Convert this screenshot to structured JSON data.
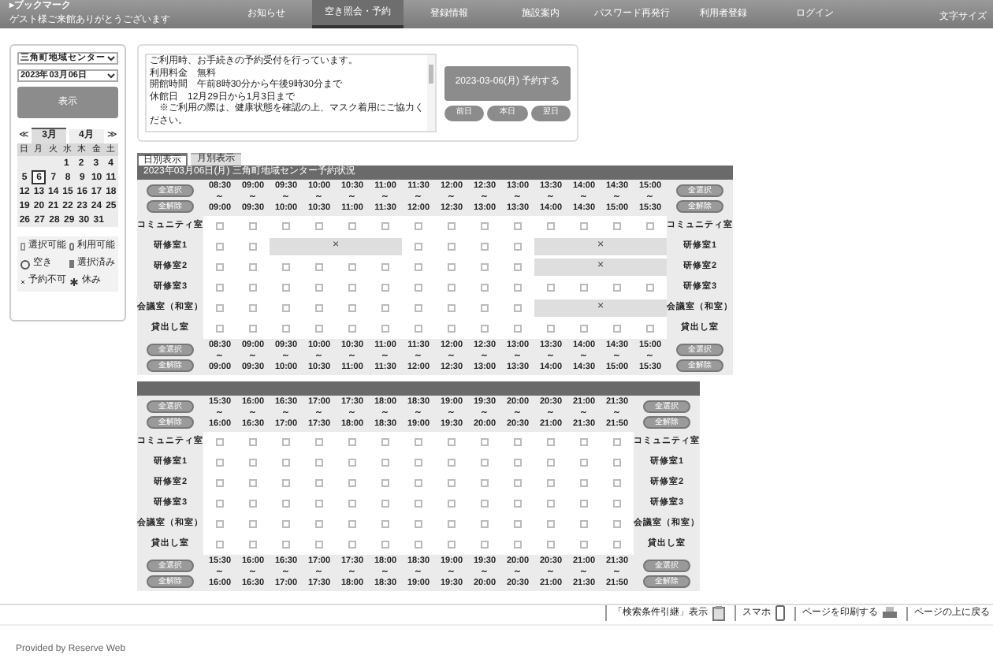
{
  "header": {
    "bookmark": "▸ブックマーク",
    "greeting": "ゲスト様ご来館ありがとうございます",
    "font_size": "文字サイズ"
  },
  "nav": [
    {
      "label": "お知らせ",
      "selected": false
    },
    {
      "label": "空き照会・予約",
      "selected": true
    },
    {
      "label": "登録情報",
      "selected": false
    },
    {
      "label": "施設案内",
      "selected": false
    },
    {
      "label": "パスワード再発行",
      "selected": false
    },
    {
      "label": "利用者登録",
      "selected": false
    },
    {
      "label": "ログイン",
      "selected": false
    }
  ],
  "sidebar": {
    "facility": "三角町地域センター",
    "date_select": "2023年03月06日",
    "show_button": "表示",
    "calendar": {
      "prev": "≪",
      "next": "≫",
      "months": [
        {
          "label": "3月",
          "selected": true
        },
        {
          "label": "4月",
          "selected": false
        }
      ],
      "weekdays": [
        "日",
        "月",
        "火",
        "水",
        "木",
        "金",
        "土"
      ],
      "weeks": [
        {
          "days": [
            {
              "day": "1",
              "selected": false
            },
            {
              "day": "2",
              "selected": false
            },
            {
              "day": "3",
              "selected": false
            },
            {
              "day": "4",
              "selected": false
            }
          ]
        },
        {
          "days": [
            {
              "day": "5",
              "selected": false
            },
            {
              "day": "6",
              "selected": true
            },
            {
              "day": "7",
              "selected": false
            },
            {
              "day": "8",
              "selected": false
            },
            {
              "day": "9",
              "selected": false
            },
            {
              "day": "10",
              "selected": false
            },
            {
              "day": "11",
              "selected": false
            }
          ]
        },
        {
          "days": [
            {
              "day": "12",
              "selected": false
            },
            {
              "day": "13",
              "selected": false
            },
            {
              "day": "14",
              "selected": false
            },
            {
              "day": "15",
              "selected": false
            },
            {
              "day": "16",
              "selected": false
            },
            {
              "day": "17",
              "selected": false
            },
            {
              "day": "18",
              "selected": false
            }
          ]
        },
        {
          "days": [
            {
              "day": "19",
              "selected": false
            },
            {
              "day": "20",
              "selected": false
            },
            {
              "day": "21",
              "selected": false
            },
            {
              "day": "22",
              "selected": false
            },
            {
              "day": "23",
              "selected": false
            },
            {
              "day": "24",
              "selected": false
            },
            {
              "day": "25",
              "selected": false
            }
          ]
        },
        {
          "days": [
            {
              "day": "26",
              "selected": false
            },
            {
              "day": "27",
              "selected": false
            },
            {
              "day": "28",
              "selected": false
            },
            {
              "day": "29",
              "selected": false
            },
            {
              "day": "30",
              "selected": false
            },
            {
              "day": "31",
              "selected": false
            }
          ]
        }
      ]
    },
    "legend": [
      {
        "kind": "checkbox",
        "label": "選択可能"
      },
      {
        "kind": "pill",
        "label": "利用可能"
      },
      {
        "kind": "circle",
        "label": "空き"
      },
      {
        "kind": "filled",
        "label": "選択済み"
      },
      {
        "kind": "cross",
        "label": "予約不可"
      },
      {
        "kind": "star",
        "label": "休み"
      }
    ]
  },
  "notice": {
    "lines": [
      "ご利用時、お手続きの予約受付を行っています。",
      "利用料金　無料",
      "開館時間　午前8時30分から午後9時30分まで",
      "休館日　12月29日から1月3日まで",
      "　※ご利用の際は、健康状態を確認の上、マスク着用にご協力ください。"
    ],
    "reserve_button": "2023-03-06(月) 予約する",
    "day_buttons": [
      "前日",
      "本日",
      "翌日"
    ]
  },
  "tabs": [
    {
      "label": "日別表示",
      "selected": true
    },
    {
      "label": "月別表示",
      "selected": false
    }
  ],
  "grids": [
    {
      "title": "2023年03月06日(月) 三角町地域センター予約状況",
      "corners": {
        "top_left": [
          "全選択",
          "全解除"
        ],
        "top_right": [
          "全選択",
          "全解除"
        ],
        "bottom_left": [
          "全選択",
          "全解除"
        ],
        "bottom_right": [
          "全選択",
          "全解除"
        ]
      },
      "times_top": [
        "08:30 ～ 09:00",
        "09:00 ～ 09:30",
        "09:30 ～ 10:00",
        "10:00 ～ 10:30",
        "10:30 ～ 11:00",
        "11:00 ～ 11:30",
        "11:30 ～ 12:00",
        "12:00 ～ 12:30",
        "12:30 ～ 13:00",
        "13:00 ～ 13:30",
        "13:30 ～ 14:00",
        "14:00 ～ 14:30",
        "14:30 ～ 15:00",
        "15:00 ～ 15:30"
      ],
      "times_bottom": [
        "08:30 ～ 09:00",
        "09:00 ～ 09:30",
        "09:30 ～ 10:00",
        "10:00 ～ 10:30",
        "10:30 ～ 11:00",
        "11:00 ～ 11:30",
        "11:30 ～ 12:00",
        "12:00 ～ 12:30",
        "12:30 ～ 13:00",
        "13:00 ～ 13:30",
        "13:30 ～ 14:00",
        "14:00 ～ 14:30",
        "14:30 ～ 15:00",
        "15:00 ～ 15:30"
      ],
      "rows": [
        {
          "label_left": "コミュニティ室",
          "label_right": "コミュニティ室",
          "booked": [
            false,
            false,
            false,
            false,
            false,
            false,
            false,
            false,
            false,
            false,
            false,
            false,
            false,
            false
          ],
          "marks": []
        },
        {
          "label_left": "研修室1",
          "label_right": "研修室1",
          "booked": [
            false,
            false,
            true,
            true,
            true,
            true,
            false,
            false,
            false,
            false,
            true,
            true,
            true,
            true
          ],
          "marks": [
            "×",
            "×"
          ]
        },
        {
          "label_left": "研修室2",
          "label_right": "研修室2",
          "booked": [
            false,
            false,
            false,
            false,
            false,
            false,
            false,
            false,
            false,
            false,
            true,
            true,
            true,
            true
          ],
          "marks": [
            "×"
          ]
        },
        {
          "label_left": "研修室3",
          "label_right": "研修室3",
          "booked": [
            false,
            false,
            false,
            false,
            false,
            false,
            false,
            false,
            false,
            false,
            false,
            false,
            false,
            false
          ],
          "marks": []
        },
        {
          "label_left": "会議室（和室）",
          "label_right": "会議室（和室）",
          "booked": [
            false,
            false,
            false,
            false,
            false,
            false,
            false,
            false,
            false,
            false,
            true,
            true,
            true,
            true
          ],
          "marks": [
            "×"
          ]
        },
        {
          "label_left": "貸出し室",
          "label_right": "貸出し室",
          "booked": [
            false,
            false,
            false,
            false,
            false,
            false,
            false,
            false,
            false,
            false,
            false,
            false,
            false,
            false
          ],
          "marks": []
        }
      ]
    },
    {
      "corners": {
        "top_left": [
          "全選択",
          "全解除"
        ],
        "top_right": [
          "全選択",
          "全解除"
        ],
        "bottom_left": [
          "全選択",
          "全解除"
        ],
        "bottom_right": [
          "全選択",
          "全解除"
        ]
      },
      "times_top": [
        "15:30 ～ 16:00",
        "16:00 ～ 16:30",
        "16:30 ～ 17:00",
        "17:00 ～ 17:30",
        "17:30 ～ 18:00",
        "18:00 ～ 18:30",
        "18:30 ～ 19:00",
        "19:00 ～ 19:30",
        "19:30 ～ 20:00",
        "20:00 ～ 20:30",
        "20:30 ～ 21:00",
        "21:00 ～ 21:30",
        "21:30 ～ 21:50"
      ],
      "times_bottom": [
        "15:30 ～ 16:00",
        "16:00 ～ 16:30",
        "16:30 ～ 17:00",
        "17:00 ～ 17:30",
        "17:30 ～ 18:00",
        "18:00 ～ 18:30",
        "18:30 ～ 19:00",
        "19:00 ～ 19:30",
        "19:30 ～ 20:00",
        "20:00 ～ 20:30",
        "20:30 ～ 21:00",
        "21:00 ～ 21:30",
        "21:30 ～ 21:50"
      ],
      "rows": [
        {
          "label_left": "コミュニティ室",
          "label_right": "コミュニティ室",
          "booked": [
            false,
            false,
            false,
            false,
            false,
            false,
            false,
            false,
            false,
            false,
            false,
            false,
            false
          ],
          "marks": []
        },
        {
          "label_left": "研修室1",
          "label_right": "研修室1",
          "booked": [
            false,
            false,
            false,
            false,
            false,
            false,
            false,
            false,
            false,
            false,
            false,
            false,
            false
          ],
          "marks": []
        },
        {
          "label_left": "研修室2",
          "label_right": "研修室2",
          "booked": [
            false,
            false,
            false,
            false,
            false,
            false,
            false,
            false,
            false,
            false,
            false,
            false,
            false
          ],
          "marks": []
        },
        {
          "label_left": "研修室3",
          "label_right": "研修室3",
          "booked": [
            false,
            false,
            false,
            false,
            false,
            false,
            false,
            false,
            false,
            false,
            false,
            false,
            false
          ],
          "marks": []
        },
        {
          "label_left": "会議室（和室）",
          "label_right": "会議室（和室）",
          "booked": [
            false,
            false,
            false,
            false,
            false,
            false,
            false,
            false,
            false,
            false,
            false,
            false,
            false
          ],
          "marks": []
        },
        {
          "label_left": "貸出し室",
          "label_right": "貸出し室",
          "booked": [
            false,
            false,
            false,
            false,
            false,
            false,
            false,
            false,
            false,
            false,
            false,
            false,
            false
          ],
          "marks": []
        }
      ]
    }
  ],
  "footer": {
    "links": [
      {
        "kind": "clipboard",
        "label": "「検索条件引継」表示"
      },
      {
        "kind": "phone",
        "label": "スマホ"
      },
      {
        "kind": "printer",
        "label": "ページを印刷する"
      },
      {
        "kind": "none",
        "label": "ページの上に戻る"
      }
    ],
    "credit": "Provided by Reserve Web"
  }
}
